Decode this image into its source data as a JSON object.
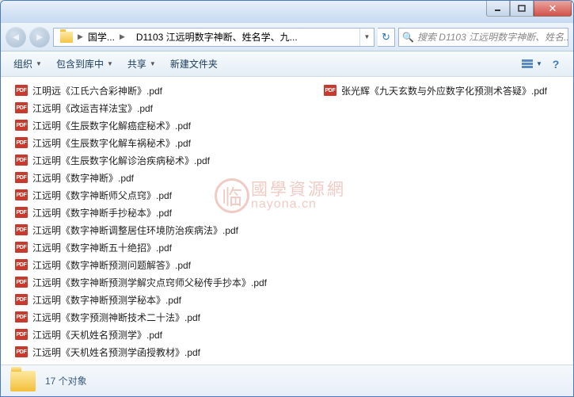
{
  "breadcrumb": {
    "root": "国学...",
    "current": "D1103 江远明数字神断、姓名学、九..."
  },
  "search": {
    "placeholder": "搜索 D1103 江远明数字神断、姓名..."
  },
  "toolbar": {
    "organize": "组织",
    "include": "包含到库中",
    "share": "共享",
    "newfolder": "新建文件夹"
  },
  "files_col1": [
    "江明远《江氏六合彩神断》.pdf",
    "江远明《改运吉祥法宝》.pdf",
    "江远明《生辰数字化解癌症秘术》.pdf",
    "江远明《生辰数字化解车祸秘术》.pdf",
    "江远明《生辰数字化解诊治疾病秘术》.pdf",
    "江远明《数字神断》.pdf",
    "江远明《数字神断师父点窍》.pdf",
    "江远明《数字神断手抄秘本》.pdf",
    "江远明《数字神断调整居住环境防治疾病法》.pdf",
    "江远明《数字神断五十绝招》.pdf",
    "江远明《数字神断预测问题解答》.pdf",
    "江远明《数字神断预测学解灾点窍师父秘传手抄本》.pdf",
    "江远明《数字神断预测学秘本》.pdf",
    "江远明《数字预测神断技术二十法》.pdf",
    "江远明《天机姓名预测学》.pdf",
    "江远明《天机姓名预测学函授教材》.pdf"
  ],
  "files_col2": [
    "张光辉《九天玄数与外应数字化预测术答疑》.pdf"
  ],
  "status": {
    "count": "17 个对象"
  },
  "watermark": {
    "logo": "临",
    "cn": "國學資源網",
    "en": "nayona.cn"
  },
  "pdf_label": "PDF"
}
